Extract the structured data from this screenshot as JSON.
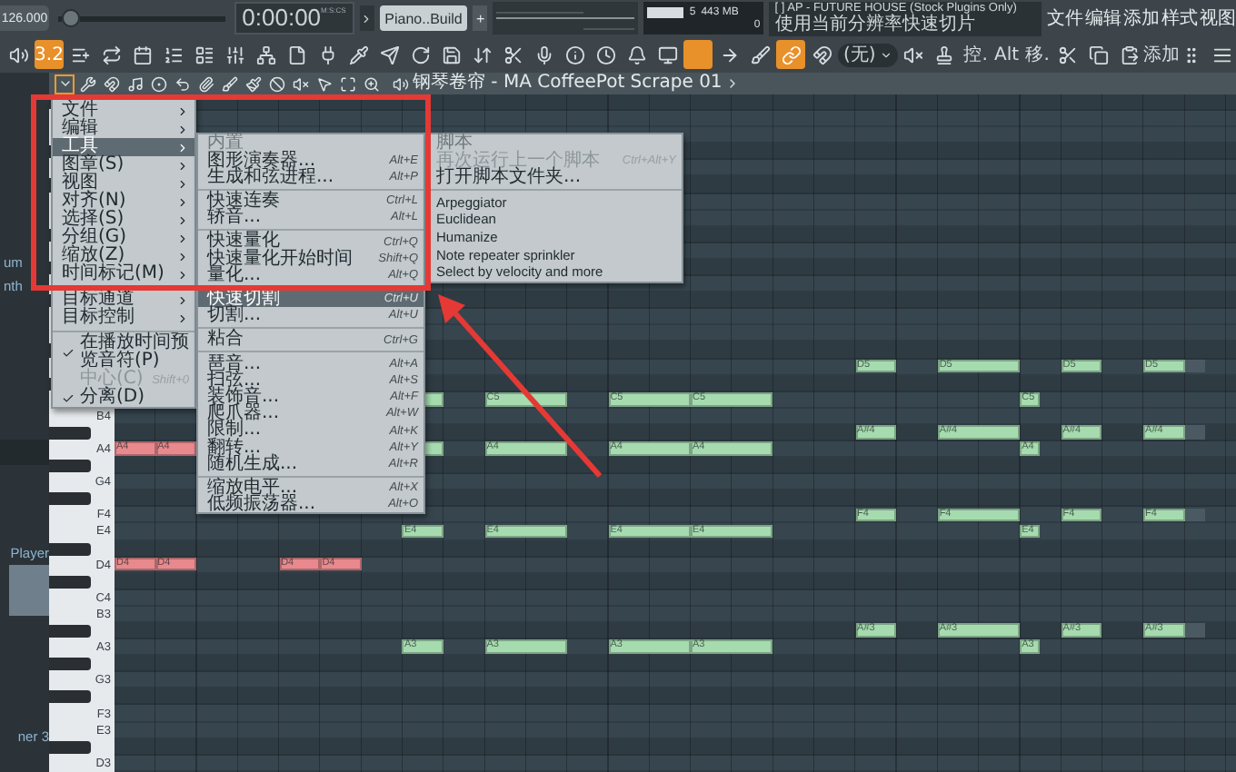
{
  "pitch_slider": {
    "level": 0.03
  },
  "transport": {
    "tempo": "126.000",
    "time": "0:00:00",
    "time_unit": "M:S:CS",
    "pattern": "Piano..Build",
    "pattern_add": "+",
    "cpu": "5",
    "memory": "443 MB",
    "polyphony": "0",
    "hint_title": "[  ] AP - FUTURE HOUSE (Stock Plugins Only)",
    "hint_text": "使用当前分辨率快速切片"
  },
  "main_menu": [
    "文件",
    "编辑",
    "添加",
    "样式",
    "视图"
  ],
  "toolbar": [
    {
      "kind": "icon",
      "on": false
    },
    {
      "kind": "text",
      "label": "3.2",
      "on": true
    },
    {
      "kind": "icon",
      "on": false
    },
    {
      "kind": "icon",
      "on": false
    },
    {
      "kind": "icon",
      "on": false
    },
    {
      "kind": "icon",
      "on": false
    },
    {
      "kind": "icon",
      "on": false
    },
    {
      "kind": "icon",
      "on": false
    },
    {
      "kind": "icon",
      "on": false
    },
    {
      "kind": "icon",
      "on": false
    },
    {
      "kind": "icon",
      "on": false
    },
    {
      "kind": "icon",
      "on": false
    },
    {
      "kind": "icon",
      "on": false
    },
    {
      "kind": "icon",
      "on": false
    },
    {
      "kind": "icon",
      "on": false
    },
    {
      "kind": "icon",
      "on": false
    },
    {
      "kind": "icon",
      "on": false
    },
    {
      "kind": "icon",
      "on": false
    },
    {
      "kind": "icon",
      "on": false
    },
    {
      "kind": "icon",
      "on": false
    },
    {
      "kind": "icon",
      "on": false
    },
    {
      "kind": "icon",
      "on": false
    },
    {
      "kind": "icon",
      "on": true
    },
    {
      "kind": "icon",
      "on": false
    },
    {
      "kind": "icon",
      "on": false
    },
    {
      "kind": "icon",
      "on": true
    },
    {
      "kind": "icon",
      "on": false
    },
    {
      "kind": "dropdown",
      "label": "(无)"
    },
    {
      "kind": "icon",
      "on": false
    },
    {
      "kind": "icon",
      "on": false
    },
    {
      "kind": "text",
      "label": "控.",
      "on": false
    },
    {
      "kind": "text",
      "label": "Alt",
      "on": false
    },
    {
      "kind": "text",
      "label": "移.",
      "on": false
    },
    {
      "kind": "icon",
      "on": false
    },
    {
      "kind": "icon",
      "on": false
    },
    {
      "kind": "icon",
      "on": false
    },
    {
      "kind": "text",
      "label": "添加",
      "on": false
    },
    {
      "kind": "icon",
      "on": false
    },
    {
      "kind": "icon",
      "on": false
    }
  ],
  "roll_toolbar": {
    "menu_open": true,
    "title": "钢琴卷帘 - MA CoffeePot Scrape 01"
  },
  "browser": {
    "fragments": [
      "um",
      "nth"
    ],
    "player_label": "Player",
    "footer_label": "ner 3"
  },
  "context_menu": {
    "items": [
      {
        "kind": "submenu",
        "label": "文件",
        "selected": false
      },
      {
        "kind": "submenu",
        "label": "编辑",
        "selected": false
      },
      {
        "kind": "submenu",
        "label": "工具",
        "selected": true
      },
      {
        "kind": "submenu",
        "label": "图章(S)",
        "selected": false
      },
      {
        "kind": "submenu",
        "label": "视图",
        "selected": false
      },
      {
        "kind": "submenu",
        "label": "对齐(N)",
        "selected": false
      },
      {
        "kind": "submenu",
        "label": "选择(S)",
        "selected": false
      },
      {
        "kind": "submenu",
        "label": "分组(G)",
        "selected": false
      },
      {
        "kind": "submenu",
        "label": "缩放(Z)",
        "selected": false
      },
      {
        "kind": "submenu",
        "label": "时间标记(M)",
        "selected": false
      },
      {
        "kind": "divider"
      },
      {
        "kind": "submenu",
        "label": "目标通道",
        "selected": false
      },
      {
        "kind": "submenu",
        "label": "目标控制",
        "selected": false
      },
      {
        "kind": "divider"
      },
      {
        "kind": "check",
        "label": "在播放时间预览音符(P)",
        "checked": true,
        "disabled": false
      },
      {
        "kind": "check",
        "label": "中心(C)",
        "shortcut": "Shift+0",
        "checked": false,
        "disabled": true
      },
      {
        "kind": "check",
        "label": "分离(D)",
        "checked": true,
        "disabled": false
      }
    ]
  },
  "tools_menu": {
    "header": "内置",
    "items": [
      {
        "kind": "command",
        "label": "图形演奏器...",
        "shortcut": "Alt+E",
        "selected": false
      },
      {
        "kind": "command",
        "label": "生成和弦进程...",
        "shortcut": "Alt+P",
        "selected": false
      },
      {
        "kind": "divider"
      },
      {
        "kind": "command",
        "label": "快速连奏",
        "shortcut": "Ctrl+L",
        "selected": false
      },
      {
        "kind": "command",
        "label": "轿音...",
        "shortcut": "Alt+L",
        "selected": false
      },
      {
        "kind": "divider"
      },
      {
        "kind": "command",
        "label": "快速量化",
        "shortcut": "Ctrl+Q",
        "selected": false
      },
      {
        "kind": "command",
        "label": "快速量化开始时间",
        "shortcut": "Shift+Q",
        "selected": false
      },
      {
        "kind": "command",
        "label": "量化...",
        "shortcut": "Alt+Q",
        "selected": false
      },
      {
        "kind": "divider"
      },
      {
        "kind": "command",
        "label": "快速切割",
        "shortcut": "Ctrl+U",
        "selected": true
      },
      {
        "kind": "command",
        "label": "切割...",
        "shortcut": "Alt+U",
        "selected": false
      },
      {
        "kind": "divider"
      },
      {
        "kind": "command",
        "label": "粘合",
        "shortcut": "Ctrl+G",
        "selected": false
      },
      {
        "kind": "divider"
      },
      {
        "kind": "command",
        "label": "琶音...",
        "shortcut": "Alt+A",
        "selected": false
      },
      {
        "kind": "command",
        "label": "扫弦...",
        "shortcut": "Alt+S",
        "selected": false
      },
      {
        "kind": "command",
        "label": "装饰音...",
        "shortcut": "Alt+F",
        "selected": false
      },
      {
        "kind": "command",
        "label": "爬爪器...",
        "shortcut": "Alt+W",
        "selected": false
      },
      {
        "kind": "command",
        "label": "限制...",
        "shortcut": "Alt+K",
        "selected": false
      },
      {
        "kind": "command",
        "label": "翻转...",
        "shortcut": "Alt+Y",
        "selected": false
      },
      {
        "kind": "command",
        "label": "随机生成...",
        "shortcut": "Alt+R",
        "selected": false
      },
      {
        "kind": "divider"
      },
      {
        "kind": "command",
        "label": "缩放电平...",
        "shortcut": "Alt+X",
        "selected": false
      },
      {
        "kind": "command",
        "label": "低频振荡器...",
        "shortcut": "Alt+O",
        "selected": false
      }
    ]
  },
  "scripts_menu": {
    "header": "脚本",
    "items": [
      {
        "kind": "command",
        "label": "再次运行上一个脚本",
        "shortcut": "Ctrl+Alt+Y",
        "disabled": true
      },
      {
        "kind": "command",
        "label": "打开脚本文件夹...",
        "disabled": false
      },
      {
        "kind": "divider"
      },
      {
        "kind": "script",
        "label": "Arpeggiator",
        "disabled": false
      },
      {
        "kind": "script",
        "label": "Euclidean",
        "disabled": false
      },
      {
        "kind": "script",
        "label": "Humanize",
        "disabled": false
      },
      {
        "kind": "script",
        "label": "Note repeater sprinkler",
        "disabled": false
      },
      {
        "kind": "script",
        "label": "Select by velocity and more",
        "disabled": false
      }
    ]
  },
  "roll": {
    "rows": [
      {},
      {},
      {},
      {},
      {},
      {},
      {},
      {},
      {},
      {},
      {},
      {},
      {},
      {},
      {},
      {},
      {
        "cells": [
          {
            "kind": "gap"
          },
          {
            "kind": "gap"
          },
          {
            "kind": "gap"
          },
          {
            "kind": "gap"
          },
          {
            "kind": "gap"
          },
          {
            "kind": "gap"
          },
          {
            "kind": "gap"
          },
          {
            "kind": "gap"
          },
          {
            "kind": "gap"
          },
          {
            "kind": "gap"
          },
          {
            "kind": "gap"
          },
          {
            "kind": "gap"
          },
          {
            "kind": "gap"
          },
          {
            "kind": "gap"
          },
          {
            "kind": "gap"
          },
          {
            "kind": "gap"
          },
          {
            "kind": "gap"
          },
          {
            "kind": "gap"
          },
          {
            "kind": "note",
            "label": "D5",
            "color": "#a6dbb0"
          },
          {
            "kind": "gap"
          },
          {
            "kind": "note",
            "label": "D5",
            "color": "#a6dbb0"
          },
          {
            "kind": "hold"
          },
          {
            "kind": "gap"
          },
          {
            "kind": "note",
            "label": "D5",
            "color": "#a6dbb0"
          },
          {
            "kind": "gap"
          },
          {
            "kind": "note",
            "label": "D5",
            "color": "#a6dbb0"
          },
          {
            "kind": "ghost"
          }
        ]
      },
      {},
      {
        "cells": [
          {
            "kind": "gap"
          },
          {
            "kind": "gap"
          },
          {
            "kind": "gap"
          },
          {
            "kind": "gap"
          },
          {
            "kind": "gap"
          },
          {
            "kind": "gap"
          },
          {
            "kind": "gap"
          },
          {
            "kind": "note",
            "color": "#a6dbb0"
          },
          {
            "kind": "gap"
          },
          {
            "kind": "note",
            "label": "C5",
            "color": "#a6dbb0"
          },
          {
            "kind": "hold"
          },
          {
            "kind": "gap"
          },
          {
            "kind": "note",
            "label": "C5",
            "color": "#a6dbb0"
          },
          {
            "kind": "hold"
          },
          {
            "kind": "note",
            "label": "C5",
            "color": "#a6dbb0"
          },
          {
            "kind": "hold"
          },
          {
            "kind": "gap"
          },
          {
            "kind": "gap"
          },
          {
            "kind": "gap"
          },
          {
            "kind": "gap"
          },
          {
            "kind": "gap"
          },
          {
            "kind": "gap"
          },
          {
            "kind": "short_note",
            "label": "C5",
            "color": "#a6dbb0"
          }
        ]
      },
      {
        "label": "B4"
      },
      {
        "cells": [
          {
            "kind": "gap"
          },
          {
            "kind": "gap"
          },
          {
            "kind": "gap"
          },
          {
            "kind": "gap"
          },
          {
            "kind": "gap"
          },
          {
            "kind": "gap"
          },
          {
            "kind": "gap"
          },
          {
            "kind": "gap"
          },
          {
            "kind": "gap"
          },
          {
            "kind": "gap"
          },
          {
            "kind": "gap"
          },
          {
            "kind": "gap"
          },
          {
            "kind": "gap"
          },
          {
            "kind": "gap"
          },
          {
            "kind": "gap"
          },
          {
            "kind": "gap"
          },
          {
            "kind": "gap"
          },
          {
            "kind": "gap"
          },
          {
            "kind": "note",
            "label": "A#4",
            "color": "#a6dbb0"
          },
          {
            "kind": "gap"
          },
          {
            "kind": "note",
            "label": "A#4",
            "color": "#a6dbb0"
          },
          {
            "kind": "hold"
          },
          {
            "kind": "gap"
          },
          {
            "kind": "note",
            "label": "A#4",
            "color": "#a6dbb0"
          },
          {
            "kind": "gap"
          },
          {
            "kind": "note",
            "label": "A#4",
            "color": "#a6dbb0"
          },
          {
            "kind": "ghost"
          }
        ]
      },
      {
        "label": "A4",
        "cells": [
          {
            "kind": "note",
            "label": "A4",
            "color": "#e8898e"
          },
          {
            "kind": "note",
            "label": "A4",
            "color": "#e8898e"
          },
          {
            "kind": "gap"
          },
          {
            "kind": "gap"
          },
          {
            "kind": "gap"
          },
          {
            "kind": "gap"
          },
          {
            "kind": "gap"
          },
          {
            "kind": "note",
            "color": "#a6dbb0"
          },
          {
            "kind": "gap"
          },
          {
            "kind": "note",
            "label": "A4",
            "color": "#a6dbb0"
          },
          {
            "kind": "hold"
          },
          {
            "kind": "gap"
          },
          {
            "kind": "note",
            "label": "A4",
            "color": "#a6dbb0"
          },
          {
            "kind": "hold"
          },
          {
            "kind": "note",
            "label": "A4",
            "color": "#a6dbb0"
          },
          {
            "kind": "hold"
          },
          {
            "kind": "gap"
          },
          {
            "kind": "gap"
          },
          {
            "kind": "gap"
          },
          {
            "kind": "gap"
          },
          {
            "kind": "gap"
          },
          {
            "kind": "gap"
          },
          {
            "kind": "short_note",
            "label": "A4",
            "color": "#a6dbb0"
          }
        ]
      },
      {},
      {
        "label": "G4"
      },
      {},
      {
        "label": "F4",
        "cells": [
          {
            "kind": "gap"
          },
          {
            "kind": "gap"
          },
          {
            "kind": "gap"
          },
          {
            "kind": "gap"
          },
          {
            "kind": "gap"
          },
          {
            "kind": "gap"
          },
          {
            "kind": "gap"
          },
          {
            "kind": "gap"
          },
          {
            "kind": "gap"
          },
          {
            "kind": "gap"
          },
          {
            "kind": "gap"
          },
          {
            "kind": "gap"
          },
          {
            "kind": "gap"
          },
          {
            "kind": "gap"
          },
          {
            "kind": "gap"
          },
          {
            "kind": "gap"
          },
          {
            "kind": "gap"
          },
          {
            "kind": "gap"
          },
          {
            "kind": "note",
            "label": "F4",
            "color": "#a6dbb0"
          },
          {
            "kind": "gap"
          },
          {
            "kind": "note",
            "label": "F4",
            "color": "#a6dbb0"
          },
          {
            "kind": "hold"
          },
          {
            "kind": "gap"
          },
          {
            "kind": "note",
            "label": "F4",
            "color": "#a6dbb0"
          },
          {
            "kind": "gap"
          },
          {
            "kind": "note",
            "label": "F4",
            "color": "#a6dbb0"
          },
          {
            "kind": "ghost"
          }
        ]
      },
      {
        "label": "E4",
        "cells": [
          {
            "kind": "gap"
          },
          {
            "kind": "gap"
          },
          {
            "kind": "gap"
          },
          {
            "kind": "gap"
          },
          {
            "kind": "gap"
          },
          {
            "kind": "gap"
          },
          {
            "kind": "gap"
          },
          {
            "kind": "note",
            "label": "E4",
            "color": "#a6dbb0"
          },
          {
            "kind": "gap"
          },
          {
            "kind": "note",
            "label": "E4",
            "color": "#a6dbb0"
          },
          {
            "kind": "hold"
          },
          {
            "kind": "gap"
          },
          {
            "kind": "note",
            "label": "E4",
            "color": "#a6dbb0"
          },
          {
            "kind": "hold"
          },
          {
            "kind": "note",
            "label": "E4",
            "color": "#a6dbb0"
          },
          {
            "kind": "hold"
          },
          {
            "kind": "gap"
          },
          {
            "kind": "gap"
          },
          {
            "kind": "gap"
          },
          {
            "kind": "gap"
          },
          {
            "kind": "gap"
          },
          {
            "kind": "gap"
          },
          {
            "kind": "short_note",
            "label": "E4",
            "color": "#a6dbb0"
          }
        ]
      },
      {},
      {
        "label": "D4",
        "cells": [
          {
            "kind": "note",
            "label": "D4",
            "color": "#e8898e"
          },
          {
            "kind": "note",
            "label": "D4",
            "color": "#e8898e"
          },
          {
            "kind": "gap"
          },
          {
            "kind": "gap"
          },
          {
            "kind": "note",
            "label": "D4",
            "color": "#e8898e"
          },
          {
            "kind": "note",
            "label": "D4",
            "color": "#e8898e"
          }
        ]
      },
      {},
      {
        "label": "C4"
      },
      {
        "label": "B3"
      },
      {
        "cells": [
          {
            "kind": "gap"
          },
          {
            "kind": "gap"
          },
          {
            "kind": "gap"
          },
          {
            "kind": "gap"
          },
          {
            "kind": "gap"
          },
          {
            "kind": "gap"
          },
          {
            "kind": "gap"
          },
          {
            "kind": "gap"
          },
          {
            "kind": "gap"
          },
          {
            "kind": "gap"
          },
          {
            "kind": "gap"
          },
          {
            "kind": "gap"
          },
          {
            "kind": "gap"
          },
          {
            "kind": "gap"
          },
          {
            "kind": "gap"
          },
          {
            "kind": "gap"
          },
          {
            "kind": "gap"
          },
          {
            "kind": "gap"
          },
          {
            "kind": "note",
            "label": "A#3",
            "color": "#a6dbb0"
          },
          {
            "kind": "gap"
          },
          {
            "kind": "note",
            "label": "A#3",
            "color": "#a6dbb0"
          },
          {
            "kind": "hold"
          },
          {
            "kind": "gap"
          },
          {
            "kind": "note",
            "label": "A#3",
            "color": "#a6dbb0"
          },
          {
            "kind": "gap"
          },
          {
            "kind": "note",
            "label": "A#3",
            "color": "#a6dbb0"
          },
          {
            "kind": "ghost"
          }
        ]
      },
      {
        "label": "A3",
        "cells": [
          {
            "kind": "gap"
          },
          {
            "kind": "gap"
          },
          {
            "kind": "gap"
          },
          {
            "kind": "gap"
          },
          {
            "kind": "gap"
          },
          {
            "kind": "gap"
          },
          {
            "kind": "gap"
          },
          {
            "kind": "note",
            "label": "A3",
            "color": "#a6dbb0"
          },
          {
            "kind": "gap"
          },
          {
            "kind": "note",
            "label": "A3",
            "color": "#a6dbb0"
          },
          {
            "kind": "hold"
          },
          {
            "kind": "gap"
          },
          {
            "kind": "note",
            "label": "A3",
            "color": "#a6dbb0"
          },
          {
            "kind": "hold"
          },
          {
            "kind": "note",
            "label": "A3",
            "color": "#a6dbb0"
          },
          {
            "kind": "hold"
          },
          {
            "kind": "gap"
          },
          {
            "kind": "gap"
          },
          {
            "kind": "gap"
          },
          {
            "kind": "gap"
          },
          {
            "kind": "gap"
          },
          {
            "kind": "gap"
          },
          {
            "kind": "short_note",
            "label": "A3",
            "color": "#a6dbb0"
          }
        ]
      },
      {},
      {
        "label": "G3"
      },
      {},
      {
        "label": "F3"
      },
      {
        "label": "E3"
      },
      {},
      {
        "label": "D3"
      }
    ]
  }
}
